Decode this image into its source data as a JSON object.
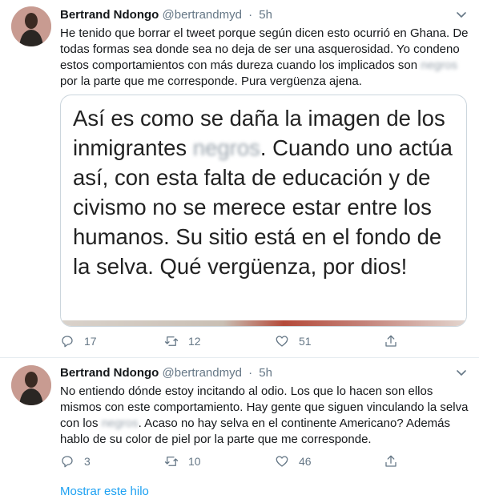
{
  "colors": {
    "text": "#14171a",
    "secondary": "#657786",
    "link": "#1da1f2",
    "border": "#e6ecf0"
  },
  "tweets": [
    {
      "name": "Bertrand Ndongo",
      "handle": "@bertrandmyd",
      "dot": "·",
      "time": "5h",
      "text_parts": [
        "He tenido que borrar el tweet porque según dicen esto ocurrió en Ghana. De todas formas sea donde sea no deja de ser una asquerosidad. Yo condeno estos comportamientos con más dureza cuando los implicados son ",
        "negros",
        " por la parte que me corresponde. Pura vergüenza ajena."
      ],
      "card": {
        "text_parts": [
          "Así es como se daña la imagen de los inmigrantes ",
          "negros",
          ". Cuando uno actúa así, con esta falta de educación y de civismo no se merece estar entre los humanos. Su sitio está en el fondo de la selva. Qué vergüenza, por dios!"
        ]
      },
      "replies": "17",
      "retweets": "12",
      "likes": "51",
      "avatar_icon": "profile-photo",
      "reply_icon": "reply-icon",
      "retweet_icon": "retweet-icon",
      "like_icon": "heart-icon",
      "share_icon": "share-icon",
      "caret_icon": "chevron-down-icon"
    },
    {
      "name": "Bertrand Ndongo",
      "handle": "@bertrandmyd",
      "dot": "·",
      "time": "5h",
      "text_parts": [
        "No entiendo dónde estoy incitando al odio. Los que lo hacen son ellos mismos con este comportamiento. Hay gente que siguen vinculando la selva con los ",
        "negros",
        ". Acaso no hay selva en el continente Americano? Además hablo de su color de piel por la parte que me corresponde."
      ],
      "replies": "3",
      "retweets": "10",
      "likes": "46",
      "show_thread": "Mostrar este hilo"
    }
  ]
}
